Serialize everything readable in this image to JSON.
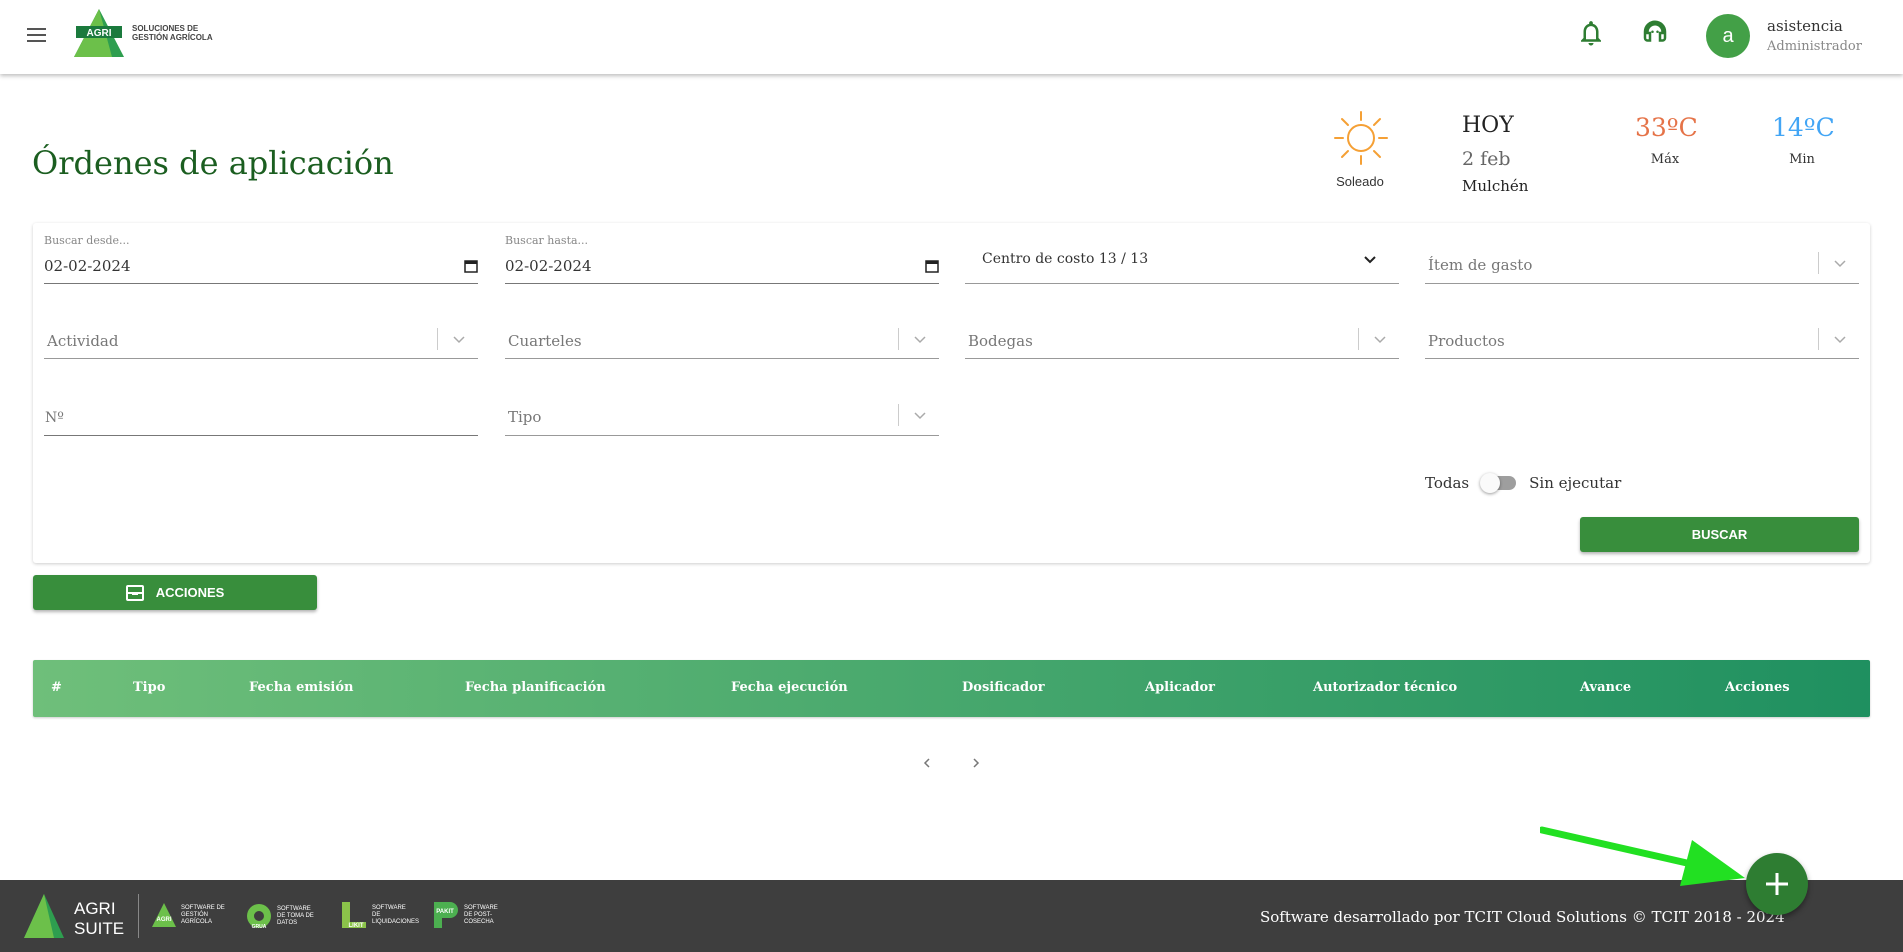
{
  "header": {
    "logo_line1": "SOLUCIONES DE",
    "logo_line2": "GESTIÓN AGRÍCOLA",
    "logo_mark": "AGRI",
    "user_initial": "a",
    "user_name": "asistencia",
    "user_role": "Administrador",
    "icons": [
      "menu-icon",
      "bell-icon",
      "support-headset-icon"
    ]
  },
  "page": {
    "title": "Órdenes de aplicación"
  },
  "weather": {
    "condition": "Soleado",
    "day": "HOY",
    "date": "2 feb",
    "city": "Mulchén",
    "max": "33ºC",
    "max_label": "Máx",
    "min": "14ºC",
    "min_label": "Min",
    "icon": "sun-icon"
  },
  "filters": {
    "date_from_label": "Buscar desde...",
    "date_from_value": "02-02-2024",
    "date_to_label": "Buscar hasta...",
    "date_to_value": "02-02-2024",
    "cost_center": "Centro de costo 13 / 13",
    "expense_item": "Ítem de gasto",
    "activity": "Actividad",
    "barracks": "Cuarteles",
    "warehouses": "Bodegas",
    "products": "Productos",
    "number": "Nº",
    "type": "Tipo",
    "toggle_left": "Todas",
    "toggle_right": "Sin ejecutar",
    "search_button": "BUSCAR"
  },
  "actions_button": "ACCIONES",
  "table": {
    "columns": [
      "#",
      "Tipo",
      "Fecha emisión",
      "Fecha planificación",
      "Fecha ejecución",
      "Dosificador",
      "Aplicador",
      "Autorizador técnico",
      "Avance",
      "Acciones"
    ]
  },
  "footer": {
    "brand": "AGRI SUITE",
    "text": "Software desarrollado por TCIT Cloud Solutions © TCIT 2018 - 2024",
    "products": [
      {
        "name": "SOFTWARE DE GESTIÓN AGRÍCOLA"
      },
      {
        "name": "SOFTWARE DE TOMA DE DATOS"
      },
      {
        "name": "SOFTWARE DE LIQUIDACIONES"
      },
      {
        "name": "SOFTWARE DE POST-COSECHA"
      }
    ],
    "product_marks": [
      "AGRI",
      "GRUA",
      "LIKIT",
      "PAKIT"
    ]
  },
  "colors": {
    "primary": "#388e3c",
    "title": "#1b5e20",
    "max_temp": "#e57348",
    "min_temp": "#42a5f5",
    "footer": "#3e3e3e",
    "arrow": "#22e022"
  }
}
